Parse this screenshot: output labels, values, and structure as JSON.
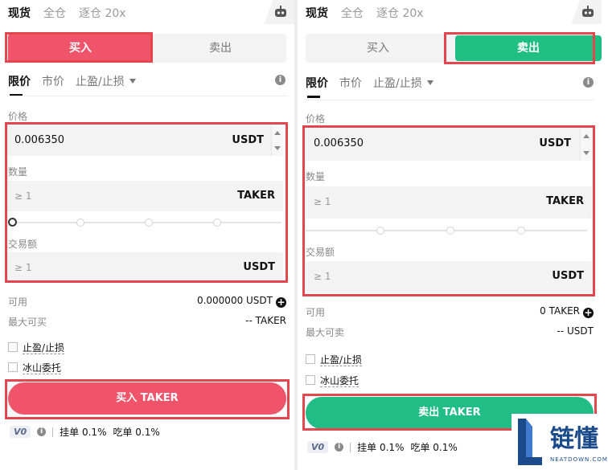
{
  "left": {
    "tabs": [
      "现货",
      "全仓",
      "逐仓 20x"
    ],
    "side_buy": "买入",
    "side_sell": "卖出",
    "order_types": [
      "限价",
      "市价",
      "止盈/止损"
    ],
    "price_label": "价格",
    "price_value": "0.006350",
    "price_unit": "USDT",
    "qty_label": "数量",
    "qty_placeholder": "≥ 1",
    "qty_unit": "TAKER",
    "amount_label": "交易额",
    "amount_placeholder": "≥ 1",
    "amount_unit": "USDT",
    "available_label": "可用",
    "available_value": "0.000000 USDT",
    "max_label": "最大可买",
    "max_value": "-- TAKER",
    "tpsl_label": "止盈/止损",
    "iceberg_label": "冰山委托",
    "action_button": "买入 TAKER",
    "vip": "V0",
    "maker_fee": "挂单 0.1%",
    "taker_fee": "吃单 0.1%"
  },
  "right": {
    "tabs": [
      "现货",
      "全仓",
      "逐仓 20x"
    ],
    "side_buy": "买入",
    "side_sell": "卖出",
    "order_types": [
      "限价",
      "市价",
      "止盈/止损"
    ],
    "price_label": "价格",
    "price_value": "0.006350",
    "price_unit": "USDT",
    "qty_label": "数量",
    "qty_placeholder": "≥ 1",
    "qty_unit": "TAKER",
    "amount_label": "交易额",
    "amount_placeholder": "≥ 1",
    "amount_unit": "USDT",
    "available_label": "可用",
    "available_value": "0 TAKER",
    "max_label": "最大可卖",
    "max_value": "-- USDT",
    "tpsl_label": "止盈/止损",
    "iceberg_label": "冰山委托",
    "action_button": "卖出 TAKER",
    "vip": "V0",
    "maker_fee": "挂单 0.1%",
    "taker_fee": "吃单 0.1%"
  },
  "watermark": {
    "text": "链懂",
    "sub": "NEATDOWN.COM",
    "color": "#1a4a8a"
  },
  "colors": {
    "buy": "#f0546b",
    "sell": "#21bd86",
    "highlight": "#e2464f"
  }
}
